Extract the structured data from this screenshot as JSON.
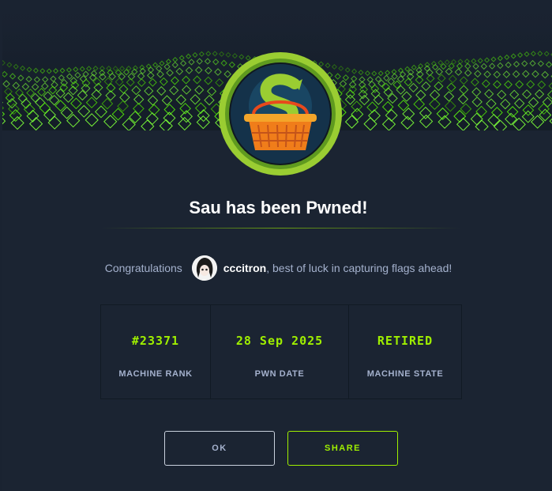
{
  "colors": {
    "accent": "#9fef00",
    "background": "#1b2432",
    "text_muted": "#a4b1cd"
  },
  "banner": {
    "icon": "green-cube-grid-wave"
  },
  "machine": {
    "logo_icon": "shopping-basket-icon",
    "title": "Sau has been Pwned!"
  },
  "congrats": {
    "prefix": "Congratulations",
    "username": "cccitron",
    "suffix": ", best of luck in capturing flags ahead!",
    "avatar_icon": "user-avatar-icon"
  },
  "stats": [
    {
      "value": "#23371",
      "label": "MACHINE RANK"
    },
    {
      "value": "28 Sep 2025",
      "label": "PWN DATE"
    },
    {
      "value": "RETIRED",
      "label": "MACHINE STATE"
    }
  ],
  "buttons": {
    "ok": "OK",
    "share": "SHARE"
  }
}
